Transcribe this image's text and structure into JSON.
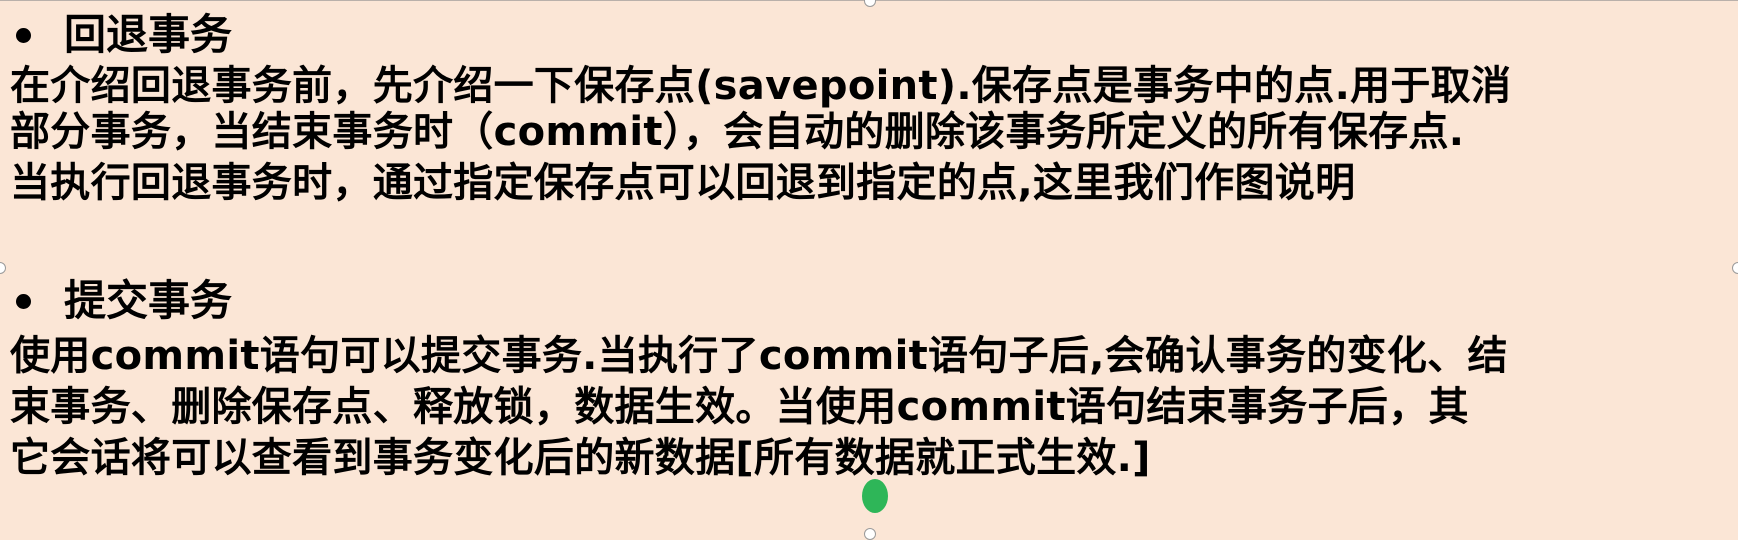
{
  "sections": [
    {
      "heading": "回退事务",
      "lines": [
        "在介绍回退事务前，先介绍一下保存点(savepoint).保存点是事务中的点.用于取消",
        "部分事务，当结束事务时（commit），会自动的删除该事务所定义的所有保存点.",
        "当执行回退事务时，通过指定保存点可以回退到指定的点,这里我们作图说明"
      ]
    },
    {
      "heading": "提交事务",
      "lines": [
        "使用commit语句可以提交事务.当执行了commit语句子后,会确认事务的变化、结",
        "束事务、删除保存点、释放锁，数据生效。当使用commit语句结束事务子后，其",
        "它会话将可以查看到事务变化后的新数据[所有数据就正式生效.]"
      ]
    }
  ],
  "colors": {
    "background": "#fbe6d6",
    "text": "#000000",
    "cursor": "#17b04a"
  },
  "icons": {
    "bullet": "bullet-dot-icon",
    "cursor": "pointer-highlight-icon"
  }
}
